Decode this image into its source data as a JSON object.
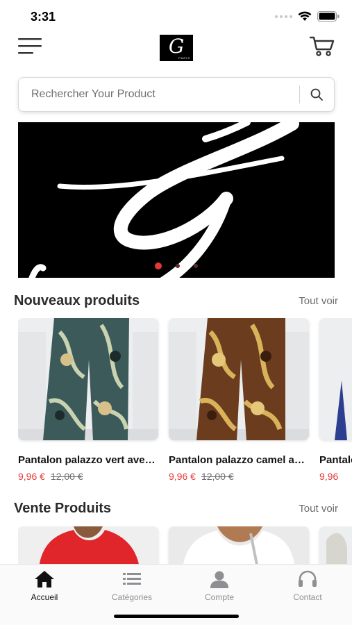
{
  "status_bar": {
    "time": "3:31",
    "icons": [
      "signal-dots-icon",
      "wifi-icon",
      "battery-icon"
    ]
  },
  "header": {
    "menu_icon": "hamburger-menu-icon",
    "logo": {
      "letter": "G",
      "subtitle": "PARIS"
    },
    "cart_icon": "shopping-cart-icon"
  },
  "search": {
    "placeholder": "Rechercher Your Product",
    "value": "",
    "icon": "search-icon"
  },
  "banner": {
    "slides": 3,
    "active_slide": 1
  },
  "new_products": {
    "title": "Nouveaux produits",
    "see_all": "Tout voir",
    "items": [
      {
        "name": "Pantalon palazzo vert avec motifs",
        "price": "9,96 €",
        "old_price": "12,00 €"
      },
      {
        "name": "Pantalon palazzo camel avec motifs",
        "price": "9,96 €",
        "old_price": "12,00 €"
      },
      {
        "name": "Pantalon palazzo bleu avec motifs",
        "price": "9,96",
        "old_price": ""
      }
    ]
  },
  "sale_products": {
    "title": "Vente Produits",
    "see_all": "Tout voir"
  },
  "tab_bar": {
    "items": [
      {
        "label": "Accueil",
        "icon": "home-icon",
        "active": true
      },
      {
        "label": "Catégories",
        "icon": "list-icon",
        "active": false
      },
      {
        "label": "Compte",
        "icon": "user-icon",
        "active": false
      },
      {
        "label": "Contact",
        "icon": "headphones-icon",
        "active": false
      }
    ]
  },
  "colors": {
    "accent": "#e53935",
    "text": "#1c1c1e",
    "muted": "#8e8e93"
  }
}
